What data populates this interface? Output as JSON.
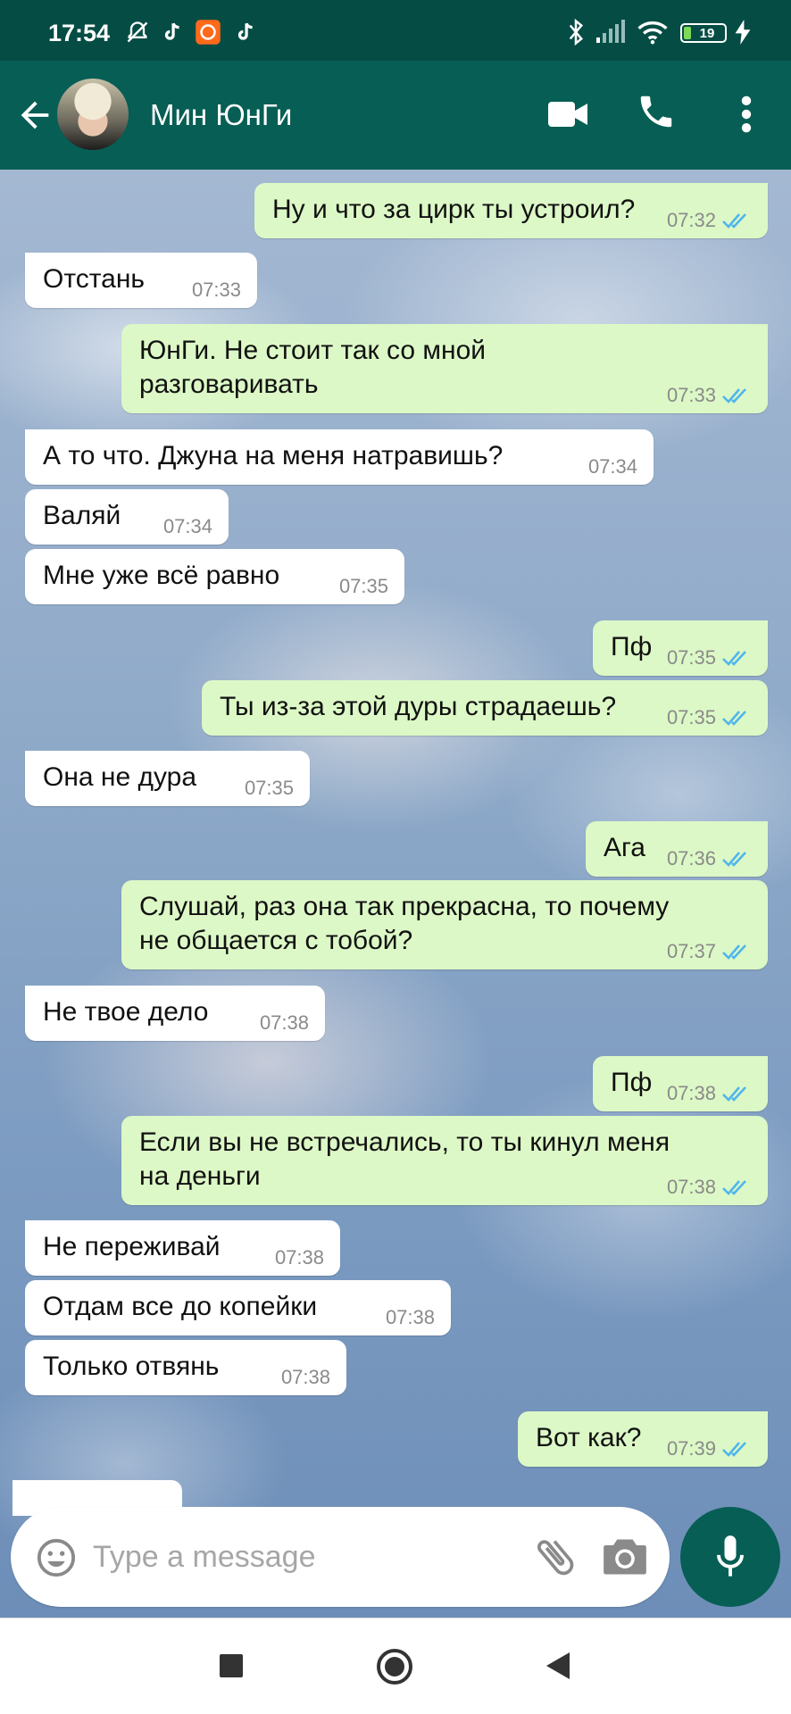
{
  "status_bar": {
    "time": "17:54",
    "battery_level": "19",
    "icons": [
      "mute-bell-icon",
      "tiktok-icon",
      "app-notification-icon",
      "tiktok-icon",
      "bluetooth-icon",
      "signal-icon",
      "wifi-icon",
      "battery-icon",
      "charging-icon"
    ]
  },
  "header": {
    "contact_name": "Мин ЮнГи",
    "icons": [
      "back-arrow-icon",
      "avatar",
      "video-call-icon",
      "phone-icon",
      "more-vert-icon"
    ]
  },
  "messages": [
    {
      "dir": "out",
      "text": "Ну и что за цирк ты устроил?",
      "time": "07:32",
      "read": true
    },
    {
      "dir": "in",
      "text": "Отстань",
      "time": "07:33"
    },
    {
      "dir": "out",
      "text_lines": [
        "ЮнГи. Не стоит так со мной",
        "разговаривать"
      ],
      "time": "07:33",
      "read": true
    },
    {
      "dir": "in",
      "text": "А то что. Джуна на меня натравишь?",
      "time": "07:34"
    },
    {
      "dir": "in",
      "text": "Валяй",
      "time": "07:34"
    },
    {
      "dir": "in",
      "text": "Мне уже всё равно",
      "time": "07:35"
    },
    {
      "dir": "out",
      "text": "Пф",
      "time": "07:35",
      "read": true
    },
    {
      "dir": "out",
      "text": "Ты из-за этой дуры страдаешь?",
      "time": "07:35",
      "read": true
    },
    {
      "dir": "in",
      "text": "Она не дура",
      "time": "07:35"
    },
    {
      "dir": "out",
      "text": "Ага",
      "time": "07:36",
      "read": true
    },
    {
      "dir": "out",
      "text_lines": [
        "Слушай, раз она так прекрасна, то почему",
        "не общается с тобой?"
      ],
      "time": "07:37",
      "read": true
    },
    {
      "dir": "in",
      "text": "Не твое дело",
      "time": "07:38"
    },
    {
      "dir": "out",
      "text": "Пф",
      "time": "07:38",
      "read": true
    },
    {
      "dir": "out",
      "text_lines": [
        "Если вы не встречались, то ты кинул меня",
        "на деньги"
      ],
      "time": "07:38",
      "read": true
    },
    {
      "dir": "in",
      "text": "Не переживай",
      "time": "07:38"
    },
    {
      "dir": "in",
      "text": "Отдам все до копейки",
      "time": "07:38"
    },
    {
      "dir": "in",
      "text": "Только отвянь",
      "time": "07:38"
    },
    {
      "dir": "out",
      "text": "Вот как?",
      "time": "07:39",
      "read": true
    }
  ],
  "input_bar": {
    "placeholder": "Type a message",
    "icons": [
      "emoji-icon",
      "attach-icon",
      "camera-icon",
      "mic-icon"
    ]
  },
  "nav_bar": {
    "icons": [
      "recents-icon",
      "home-icon",
      "back-icon"
    ]
  },
  "colors": {
    "header": "#075e54",
    "status_bar": "#054d44",
    "outgoing_bubble": "#dcf8c6",
    "incoming_bubble": "#ffffff",
    "read_ticks": "#4fb6ec"
  }
}
